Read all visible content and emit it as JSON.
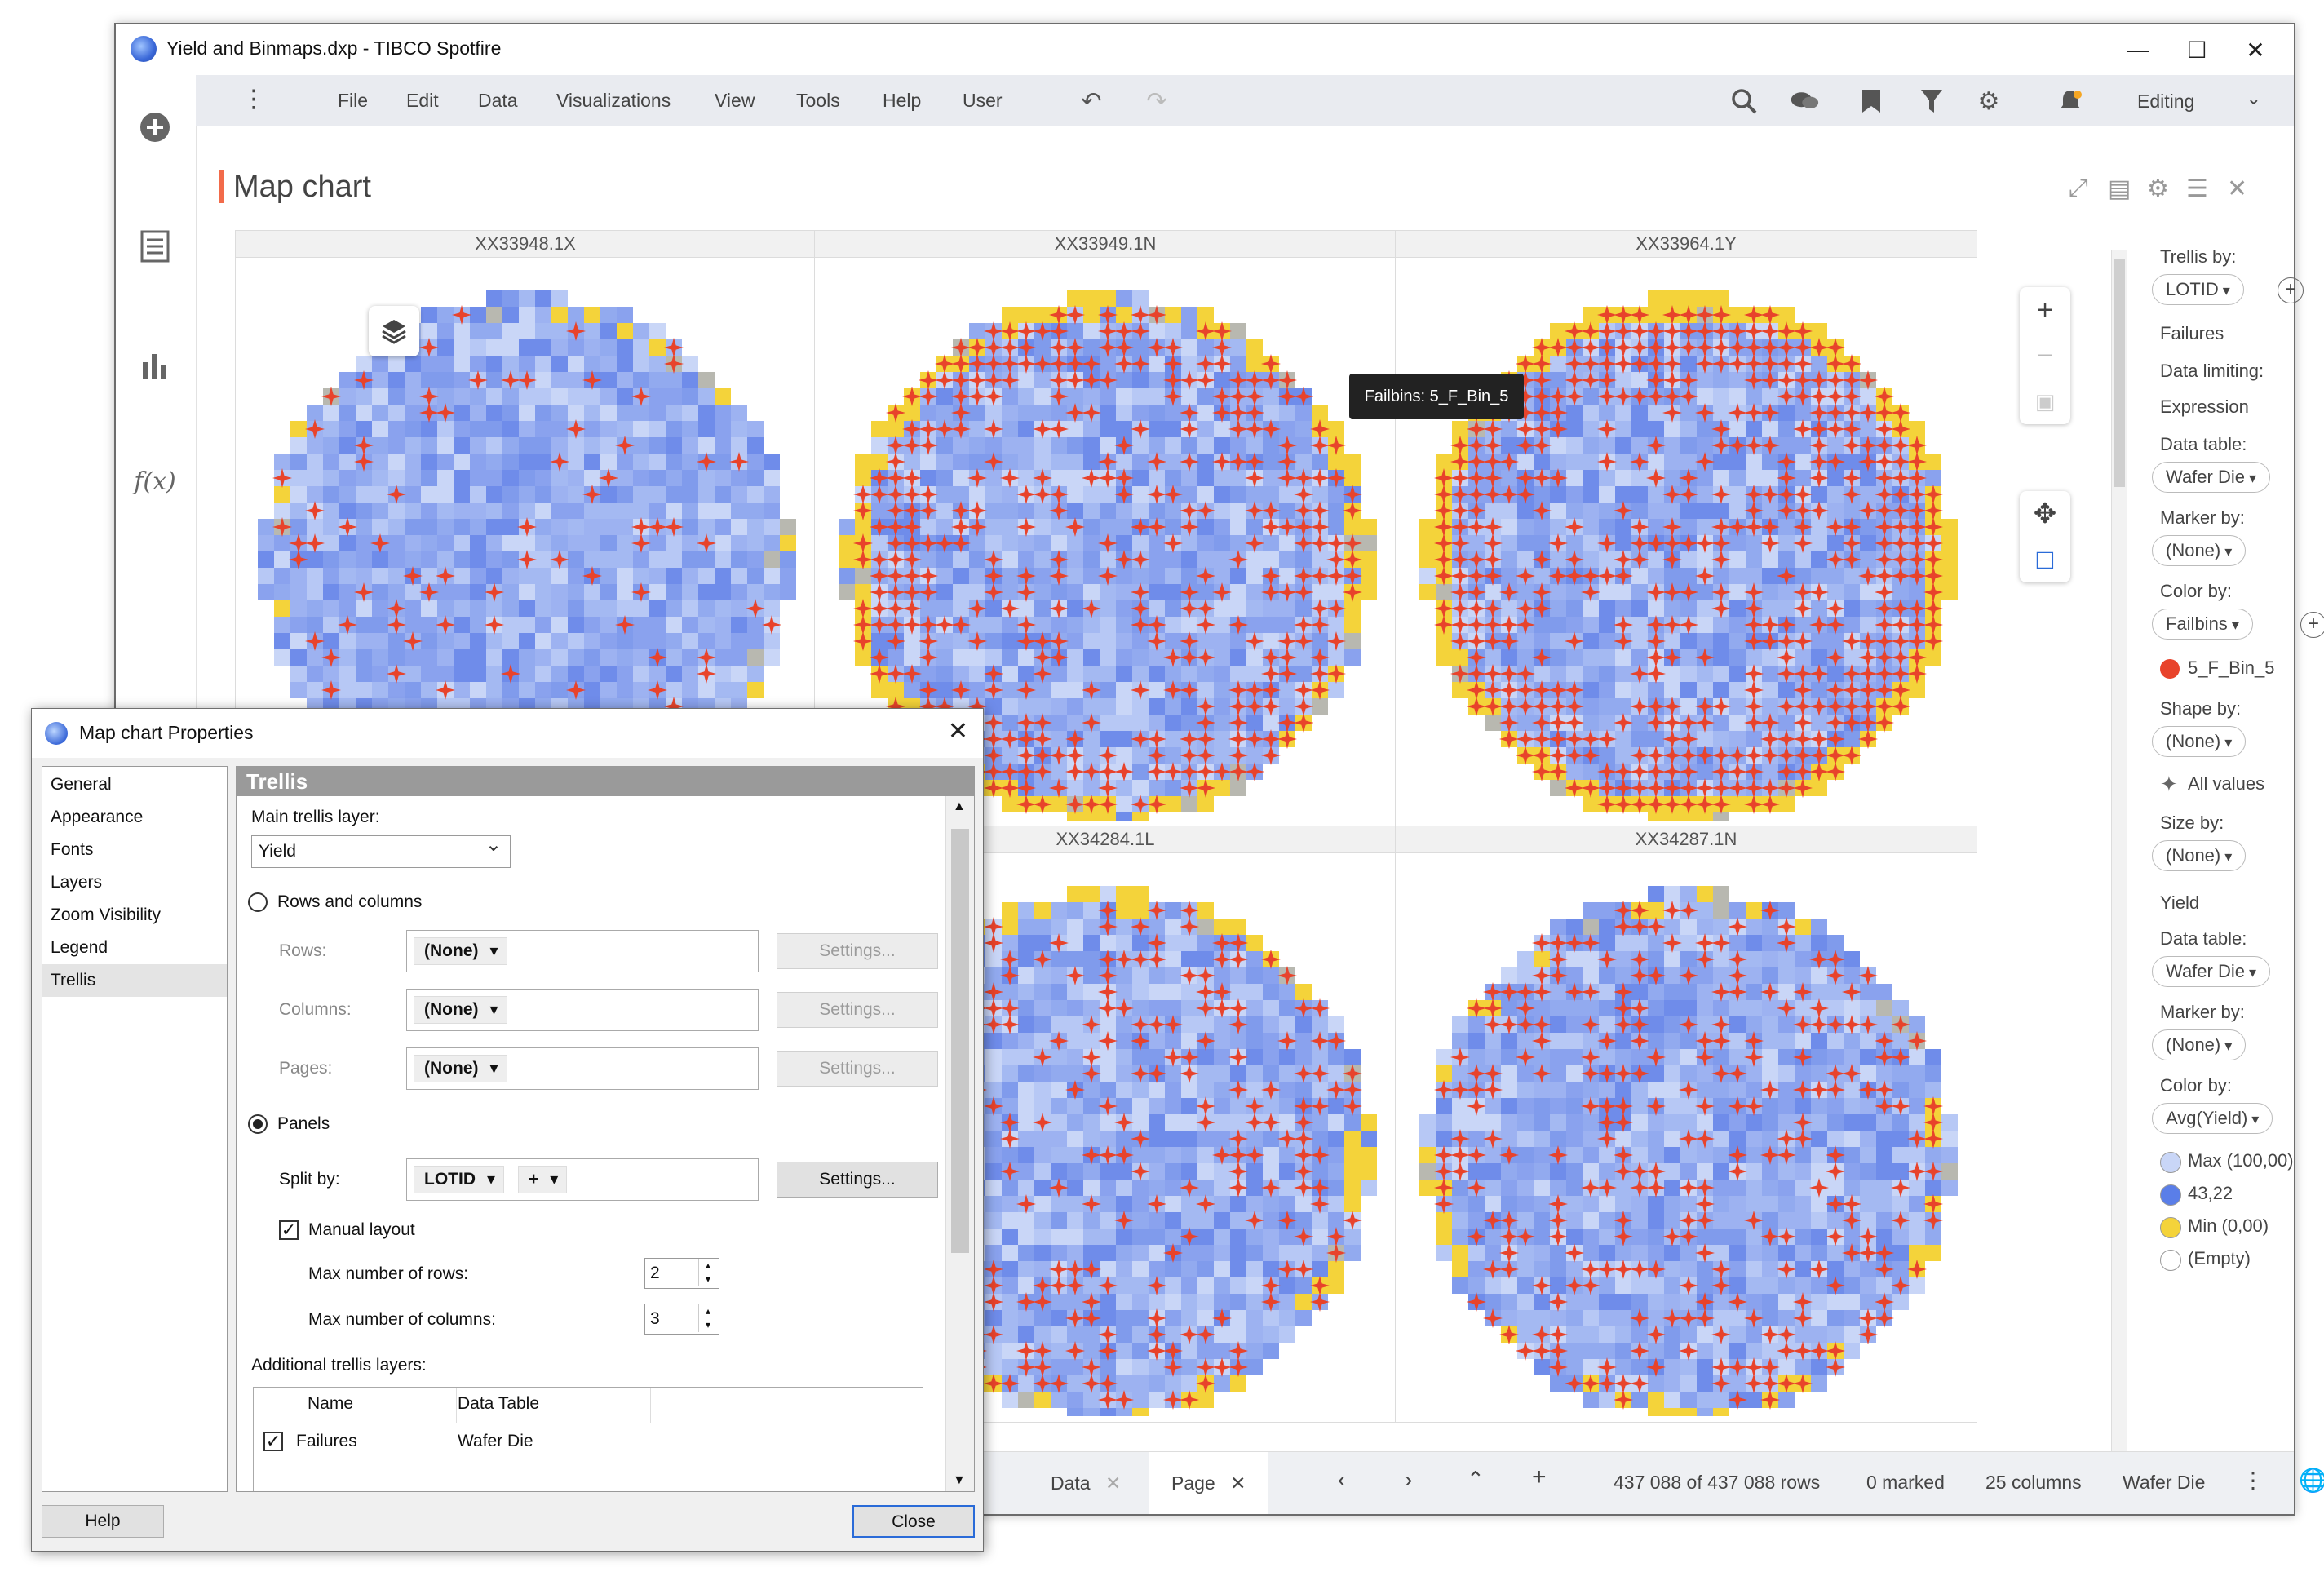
{
  "window": {
    "title": "Yield and Binmaps.dxp - TIBCO Spotfire",
    "minimize_icon": "minimize-icon",
    "maximize_icon": "maximize-icon",
    "close_icon": "close-icon"
  },
  "left_rail": [
    "add-icon",
    "data-icon",
    "visualizations-icon",
    "expression-icon"
  ],
  "menu": {
    "items": [
      "File",
      "Edit",
      "Data",
      "Visualizations",
      "View",
      "Tools",
      "Help",
      "User"
    ],
    "mode": "Editing"
  },
  "visualization": {
    "title": "Map chart",
    "accent_color": "#f26b4a",
    "panels": [
      "XX33948.1X",
      "XX33949.1N",
      "XX33964.1Y",
      "XX34284.1L",
      "XX34287.1N"
    ],
    "tooltip": "Failbins: 5_F_Bin_5"
  },
  "legend": {
    "trellis_by_label": "Trellis by:",
    "trellis_by_value": "LOTID",
    "failures_layer": {
      "name": "Failures",
      "data_limiting_label": "Data limiting:",
      "data_limiting_value": "Expression",
      "data_table_label": "Data table:",
      "data_table_value": "Wafer Die",
      "marker_by_label": "Marker by:",
      "marker_by_value": "(None)",
      "color_by_label": "Color by:",
      "color_by_value": "Failbins",
      "color_item": "5_F_Bin_5",
      "color_item_color": "#e8432b",
      "shape_by_label": "Shape by:",
      "shape_by_value": "(None)",
      "shape_item": "All values",
      "size_by_label": "Size by:",
      "size_by_value": "(None)"
    },
    "yield_layer": {
      "name": "Yield",
      "data_table_label": "Data table:",
      "data_table_value": "Wafer Die",
      "marker_by_label": "Marker by:",
      "marker_by_value": "(None)",
      "color_by_label": "Color by:",
      "color_by_value": "Avg(Yield)",
      "items": [
        {
          "label": "Max (100,00)",
          "color": "#c9d6f7"
        },
        {
          "label": "43,22",
          "color": "#5a7ee8"
        },
        {
          "label": "Min (0,00)",
          "color": "#f4d33a"
        },
        {
          "label": "(Empty)",
          "color": "#ffffff"
        }
      ]
    }
  },
  "status_bar": {
    "tabs": [
      "Data",
      "Page"
    ],
    "rows": "437 088 of 437 088 rows",
    "marked": "0 marked",
    "columns": "25 columns",
    "table": "Wafer Die"
  },
  "dialog": {
    "title": "Map chart Properties",
    "nav": [
      "General",
      "Appearance",
      "Fonts",
      "Layers",
      "Zoom Visibility",
      "Legend",
      "Trellis"
    ],
    "selected_nav": "Trellis",
    "section": "Trellis",
    "main_layer_label": "Main trellis layer:",
    "main_layer_value": "Yield",
    "rows_and_columns_label": "Rows and columns",
    "rows_label": "Rows:",
    "columns_label": "Columns:",
    "pages_label": "Pages:",
    "none_value": "(None)",
    "settings_label": "Settings...",
    "panels_label": "Panels",
    "split_by_label": "Split by:",
    "split_by_value": "LOTID",
    "split_by_add": "+",
    "manual_layout_label": "Manual layout",
    "max_rows_label": "Max number of rows:",
    "max_rows_value": "2",
    "max_cols_label": "Max number of columns:",
    "max_cols_value": "3",
    "additional_layers_label": "Additional trellis layers:",
    "table_headers": [
      "Name",
      "Data Table"
    ],
    "table_rows": [
      {
        "name": "Failures",
        "data_table": "Wafer Die",
        "checked": true
      }
    ],
    "help_label": "Help",
    "close_label": "Close"
  }
}
